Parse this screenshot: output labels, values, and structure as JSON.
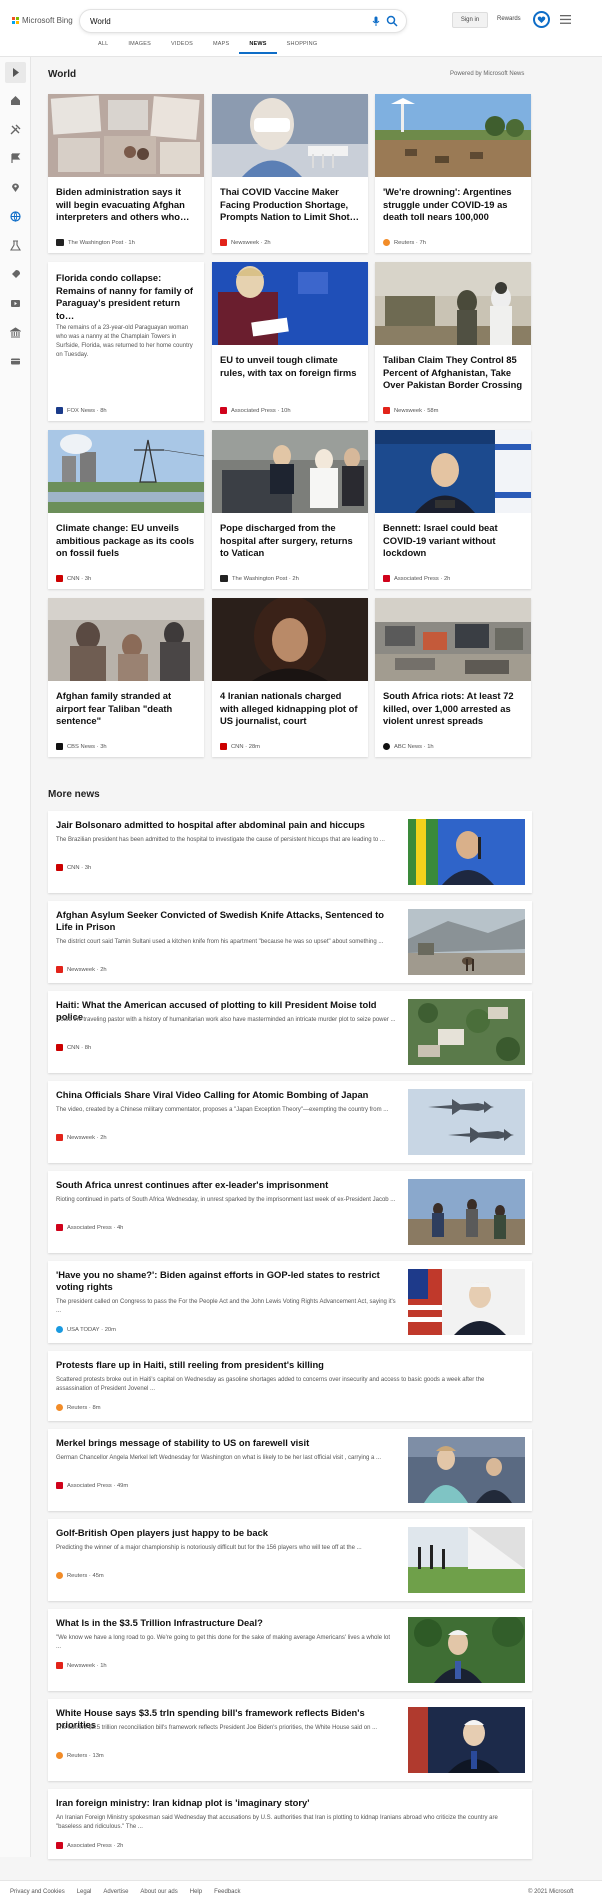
{
  "header": {
    "logo_text": "Microsoft Bing",
    "search_value": "World",
    "signin_label": "Sign in",
    "rewards_label": "Rewards",
    "tabs": [
      {
        "label": "All",
        "active": false
      },
      {
        "label": "Images",
        "active": false
      },
      {
        "label": "Videos",
        "active": false
      },
      {
        "label": "Maps",
        "active": false
      },
      {
        "label": "News",
        "active": true
      },
      {
        "label": "Shopping",
        "active": false
      }
    ]
  },
  "sidebar": {
    "icons": [
      "expand-icon",
      "home-icon",
      "tools-icon",
      "flag-icon",
      "location-icon",
      "globe-icon",
      "science-icon",
      "rocket-icon",
      "entertainment-icon",
      "bank-icon",
      "money-icon"
    ]
  },
  "world": {
    "title": "World",
    "powered_by": "Powered by Microsoft News",
    "cards": [
      {
        "title": "Biden administration says it will begin evacuating Afghan interpreters and others who…",
        "source": "The Washington Post",
        "time": "1h"
      },
      {
        "title": "Thai COVID Vaccine Maker Facing Production Shortage, Prompts Nation to Limit Shot…",
        "source": "Newsweek",
        "time": "2h"
      },
      {
        "title": "'We're drowning': Argentines struggle under COVID-19 as death toll nears 100,000",
        "source": "Reuters",
        "time": "7h"
      },
      {
        "title": "Florida condo collapse: Remains of nanny for family of Paraguay's president return to…",
        "desc": "The remains of a 23-year-old Paraguayan woman who was a nanny at the Champlain Towers in Surfside, Florida, was returned to her home country on Tuesday.",
        "source": "FOX News",
        "time": "8h"
      },
      {
        "title": "EU to unveil tough climate rules, with tax on foreign firms",
        "source": "Associated Press",
        "time": "10h"
      },
      {
        "title": "Taliban Claim They Control 85 Percent of Afghanistan, Take Over Pakistan Border Crossing",
        "source": "Newsweek",
        "time": "58m"
      },
      {
        "title": "Climate change: EU unveils ambitious package as its cools on fossil fuels",
        "source": "CNN",
        "time": "3h"
      },
      {
        "title": "Pope discharged from the hospital after surgery, returns to Vatican",
        "source": "The Washington Post",
        "time": "2h"
      },
      {
        "title": "Bennett: Israel could beat COVID-19 variant without lockdown",
        "source": "Associated Press",
        "time": "2h"
      },
      {
        "title": "Afghan family stranded at airport fear Taliban \"death sentence\"",
        "source": "CBS News",
        "time": "3h"
      },
      {
        "title": "4 Iranian nationals charged with alleged kidnapping plot of US journalist, court document…",
        "source": "CNN",
        "time": "28m"
      },
      {
        "title": "South Africa riots: At least 72 killed, over 1,000 arrested as violent unrest spreads",
        "source": "ABC News",
        "time": "1h"
      }
    ]
  },
  "more_news": {
    "title": "More news",
    "items": [
      {
        "title": "Jair Bolsonaro admitted to hospital after abdominal pain and hiccups",
        "desc": "The Brazilian president has been admitted to the hospital to investigate the cause of persistent hiccups that are leading to ...",
        "source": "CNN",
        "time": "3h"
      },
      {
        "title": "Afghan Asylum Seeker Convicted of Swedish Knife Attacks, Sentenced to Life in Prison",
        "desc": "The district court said Tamin Sultani used a kitchen knife from his apartment \"because he was so upset\" about something ...",
        "source": "Newsweek",
        "time": "2h"
      },
      {
        "title": "Haiti: What the American accused of plotting to kill President Moise told police",
        "desc": "Could the traveling pastor with a history of humanitarian work also have masterminded an intricate murder plot to seize power ...",
        "source": "CNN",
        "time": "8h"
      },
      {
        "title": "China Officials Share Viral Video Calling for Atomic Bombing of Japan",
        "desc": "The video, created by a Chinese military commentator, proposes a \"Japan Exception Theory\"—exempting the country from ...",
        "source": "Newsweek",
        "time": "2h"
      },
      {
        "title": "South Africa unrest continues after ex-leader's imprisonment",
        "desc": "Rioting continued in parts of South Africa Wednesday, in unrest sparked by the imprisonment last week of ex-President Jacob ...",
        "source": "Associated Press",
        "time": "4h"
      },
      {
        "title": "'Have you no shame?': Biden against efforts in GOP-led states to restrict voting rights",
        "desc": "The president called on Congress to pass the For the People Act and the John Lewis Voting Rights Advancement Act, saying it's ...",
        "source": "USA TODAY",
        "time": "20m"
      },
      {
        "title": "Protests flare up in Haiti, still reeling from president's killing",
        "desc": "Scattered protests broke out in Haiti's capital on Wednesday as gasoline shortages added to concerns over insecurity and access to basic goods a week after the assassination of President Jovenel ...",
        "source": "Reuters",
        "time": "8m"
      },
      {
        "title": "Merkel brings message of stability to US on farewell visit",
        "desc": "German Chancellor Angela Merkel left Wednesday for Washington on what is likely to be her last official visit , carrying a ...",
        "source": "Associated Press",
        "time": "49m"
      },
      {
        "title": "Golf-British Open players just happy to be back",
        "desc": "Predicting the winner of a major championship is notoriously difficult but for the 156 players who will tee off at the ...",
        "source": "Reuters",
        "time": "45m"
      },
      {
        "title": "What Is in the $3.5 Trillion Infrastructure Deal?",
        "desc": "\"We know we have a long road to go. We're going to get this done for the sake of making average Americans' lives a whole lot ...",
        "source": "Newsweek",
        "time": "1h"
      },
      {
        "title": "White House says $3.5 trln spending bill's framework reflects Biden's priorities",
        "desc": "The current $3.5 trillion reconciliation bill's framework reflects President Joe Biden's priorities, the White House said on ...",
        "source": "Reuters",
        "time": "13m"
      },
      {
        "title": "Iran foreign ministry: Iran kidnap plot is 'imaginary story'",
        "desc": "An Iranian Foreign Ministry spokesman said Wednesday that accusations by U.S. authorities that Iran is plotting to kidnap Iranians abroad who criticize the country are \"baseless and ridiculous.\" The ...",
        "source": "Associated Press",
        "time": "2h"
      }
    ]
  },
  "footer": {
    "links": [
      "Privacy and Cookies",
      "Legal",
      "Advertise",
      "About our ads",
      "Help",
      "Feedback"
    ],
    "copyright": "© 2021 Microsoft"
  },
  "colors": {
    "accent": "#0e6dc7",
    "washington_post": "#222222",
    "newsweek": "#e2231a",
    "reuters": "#f28c28",
    "fox": "#1a3b8a",
    "ap": "#d0021b",
    "cnn": "#cc0000",
    "cbs": "#111111",
    "abc": "#111111",
    "usatoday": "#1a9ae0"
  }
}
